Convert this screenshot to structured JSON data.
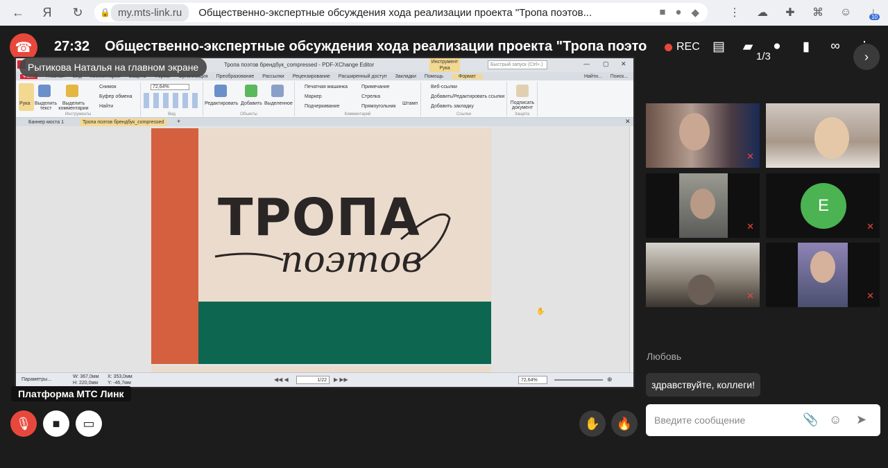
{
  "browser": {
    "domain": "my.mts-link.ru",
    "page_title": "Общественно-экспертные обсуждения хода реализации проекта \"Тропа поэтов...",
    "ext_badge": "10"
  },
  "meeting": {
    "timer": "27:32",
    "title": "Общественно-экспертные обсуждения хода реализации проекта \"Тропа поэтов и д",
    "rec_label": "REC",
    "presenter_label": "Рытикова Наталья на главном экране",
    "platform_label": "Платформа МТС Линк",
    "pager": "1/3"
  },
  "pdf": {
    "window_title": "Тропа поэтов брендбук_compressed - PDF-XChange Editor",
    "tool_context": "Инструмент Рука",
    "quick_search": "Быстрый запуск (Ctrl+.)",
    "menu": [
      "Файл",
      "Главная",
      "Вид",
      "Комментарии",
      "Защита",
      "Формы",
      "Организация",
      "Преобразование",
      "Рассылки",
      "Рецензирование",
      "Расширенный доступ",
      "Закладки",
      "Помощь",
      "Формат"
    ],
    "find_labels": [
      "Найти...",
      "Поиск..."
    ],
    "ribbon": {
      "hand": "Рука",
      "select_text": "Выделить текст",
      "select_comments": "Выделить комментарии",
      "snapshot": "Снимок",
      "clipboard": "Буфер обмена",
      "find": "Найти",
      "zoom": "72,64%",
      "edit": "Редактировать",
      "add": "Добавить",
      "selected": "Выделенное",
      "typewriter": "Печатная машинка",
      "note": "Примечание",
      "marker": "Маркер",
      "arrow": "Стрелка",
      "underline": "Подчеркивание",
      "rectangle": "Прямоугольник",
      "stamp": "Штамп",
      "web_links": "Веб-ссылки",
      "add_edit_links": "Добавить/Редактировать ссылки",
      "add_bookmark": "Добавить закладку",
      "sign": "Подписать документ",
      "groups": [
        "Инструменты",
        "Вид",
        "Объекты",
        "Комментарий",
        "Ссылки",
        "Защита"
      ]
    },
    "tabs": [
      "Баннер моста 1",
      "Тропа поэтов брендбук_compressed"
    ],
    "page_text_big": "ТРОПА",
    "page_text_script": "поэтов",
    "status": {
      "params": "Параметры...",
      "w": "W: 367,0мм",
      "h": "H: 220,0мм",
      "x": "X: 353,0мм",
      "y": "Y: -46,7мм",
      "page": "1/22",
      "zoom": "72,64%"
    }
  },
  "participants": [
    {
      "name": "participant-1",
      "type": "video",
      "muted": true
    },
    {
      "name": "participant-2",
      "type": "video",
      "muted": false
    },
    {
      "name": "participant-3",
      "type": "video",
      "muted": true
    },
    {
      "name": "participant-4",
      "type": "avatar",
      "initial": "Е",
      "muted": true
    },
    {
      "name": "participant-5",
      "type": "video",
      "muted": true
    },
    {
      "name": "participant-6",
      "type": "video",
      "muted": true
    }
  ],
  "chat": {
    "sender": "Любовь",
    "message": "здравствуйте, коллеги!",
    "placeholder": "Введите сообщение"
  },
  "colors": {
    "accent_red": "#e8483c",
    "avatar_green": "#4bb352",
    "brand_orange": "#d4603f",
    "brand_green": "#0c6650",
    "brand_beige": "#eadbcc"
  }
}
